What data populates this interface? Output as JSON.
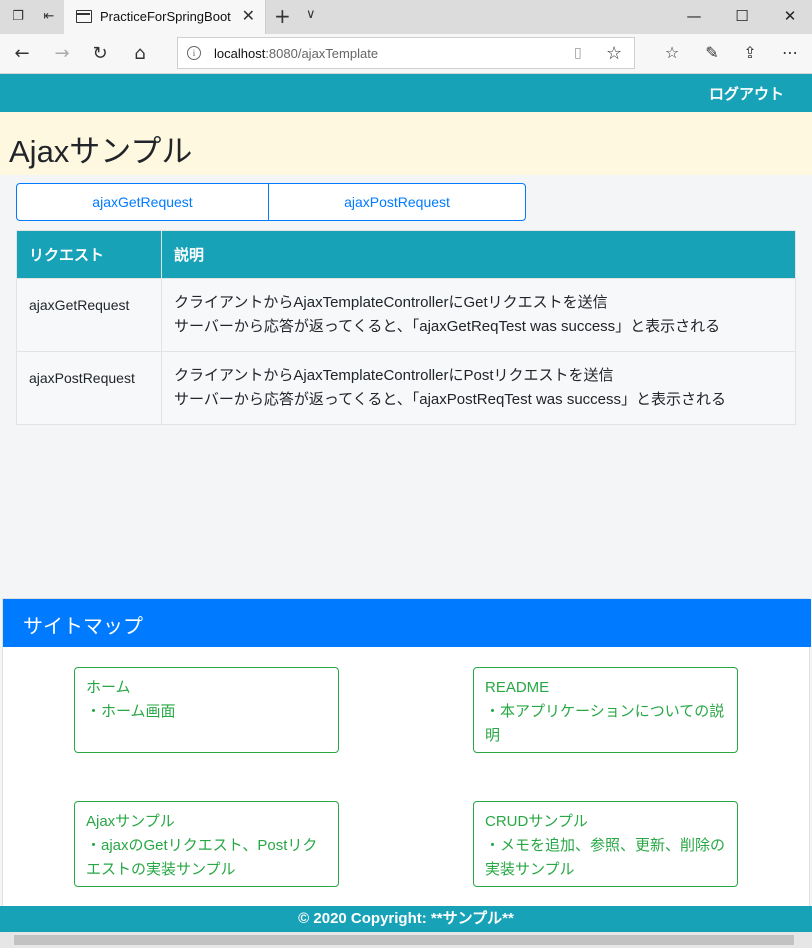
{
  "browser": {
    "tab_title": "PracticeForSpringBoot",
    "url_host": "localhost",
    "url_rest": ":8080/ajaxTemplate"
  },
  "header": {
    "logout_label": "ログアウト"
  },
  "page": {
    "title": "Ajaxサンプル"
  },
  "buttons": {
    "get_label": "ajaxGetRequest",
    "post_label": "ajaxPostRequest"
  },
  "table": {
    "headers": [
      "リクエスト",
      "説明"
    ],
    "rows": [
      {
        "request": "ajaxGetRequest",
        "desc_line1": "クライアントからAjaxTemplateControllerにGetリクエストを送信",
        "desc_line2": "サーバーから応答が返ってくると、「ajaxGetReqTest was success」と表示される"
      },
      {
        "request": "ajaxPostRequest",
        "desc_line1": "クライアントからAjaxTemplateControllerにPostリクエストを送信",
        "desc_line2": "サーバーから応答が返ってくると、「ajaxPostReqTest was success」と表示される"
      }
    ]
  },
  "sitemap": {
    "title": "サイトマップ",
    "cards": [
      {
        "title": "ホーム",
        "desc": "・ホーム画面"
      },
      {
        "title": "README",
        "desc": "・本アプリケーションについての説明"
      },
      {
        "title": "Ajaxサンプル",
        "desc": "・ajaxのGetリクエスト、Postリクエストの実装サンプル"
      },
      {
        "title": "CRUDサンプル",
        "desc": "・メモを追加、参照、更新、削除の実装サンプル"
      }
    ]
  },
  "footer": {
    "text": "© 2020 Copyright: **サンプル**"
  },
  "colors": {
    "teal": "#17a2b8",
    "blue": "#007bff",
    "green": "#28a745",
    "title_band": "#fff8e1"
  }
}
